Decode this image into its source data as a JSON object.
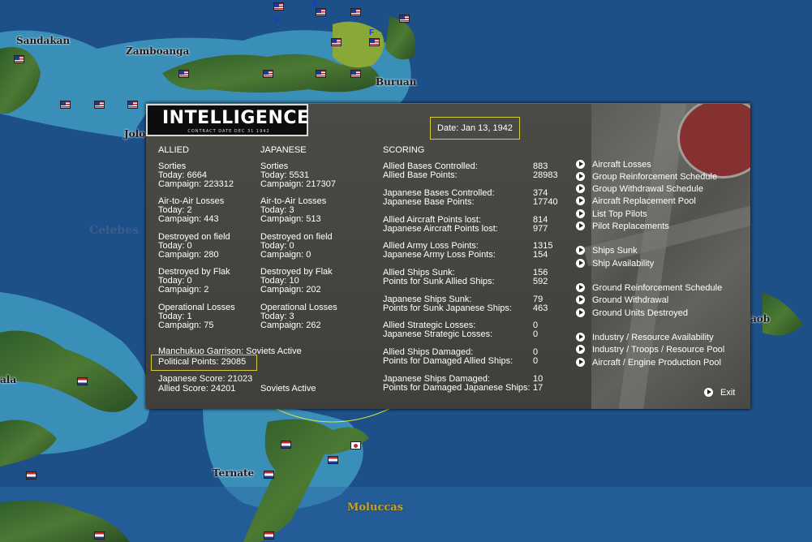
{
  "map": {
    "places": [
      "Sandakan",
      "Zamboanga",
      "Buruan",
      "Jolo",
      "Celebes",
      "Ternate",
      "Moluccas",
      "ala",
      "aob"
    ]
  },
  "intel": {
    "title": "INTELLIGENCE",
    "subtitle": "CONTRACT DATE DEC 31 1942",
    "date": "Date: Jan 13, 1942",
    "allied_header": "ALLIED",
    "japanese_header": "JAPANESE",
    "scoring_header": "SCORING",
    "allied": {
      "sorties": "Sorties",
      "sorties_today": "Today:     6664",
      "sorties_campaign": "Campaign: 223312",
      "a2a": "Air-to-Air Losses",
      "a2a_today": "Today:     2",
      "a2a_campaign": "Campaign: 443",
      "field": "Destroyed on field",
      "field_today": "Today:     0",
      "field_campaign": "Campaign: 280",
      "flak": "Destroyed by Flak",
      "flak_today": "Today:     0",
      "flak_campaign": "Campaign: 2",
      "ops": "Operational Losses",
      "ops_today": "Today:     1",
      "ops_campaign": "Campaign: 75"
    },
    "japanese": {
      "sorties": "Sorties",
      "sorties_today": "Today:     5531",
      "sorties_campaign": "Campaign: 217307",
      "a2a": "Air-to-Air Losses",
      "a2a_today": "Today:     3",
      "a2a_campaign": "Campaign: 513",
      "field": "Destroyed on field",
      "field_today": "Today:     0",
      "field_campaign": "Campaign: 0",
      "flak": "Destroyed by Flak",
      "flak_today": "Today:     10",
      "flak_campaign": "Campaign: 202",
      "ops": "Operational Losses",
      "ops_today": "Today:     3",
      "ops_campaign": "Campaign: 262"
    },
    "garrison": "Manchukuo Garrison: Soviets Active",
    "political_points": "Political Points: 29085",
    "japanese_score": "Japanese Score: 21023",
    "allied_score": "Allied Score: 24201",
    "soviets": "Soviets Active",
    "scoring": [
      {
        "labels": [
          "Allied Bases Controlled:",
          "Allied Base Points:"
        ],
        "values": [
          "883",
          "28983"
        ]
      },
      {
        "labels": [
          "Japanese Bases Controlled:",
          "Japanese Base Points:"
        ],
        "values": [
          "374",
          "17740"
        ]
      },
      {
        "labels": [
          "Allied Aircraft Points lost:",
          "Japanese Aircraft Points lost:"
        ],
        "values": [
          "814",
          "977"
        ]
      },
      {
        "labels": [
          "Allied Army Loss Points:",
          "Japanese Army Loss Points:"
        ],
        "values": [
          "1315",
          "154"
        ]
      },
      {
        "labels": [
          "Allied Ships Sunk:",
          "Points for Sunk Allied Ships:"
        ],
        "values": [
          "156",
          "592"
        ]
      },
      {
        "labels": [
          "Japanese Ships Sunk:",
          "Points for Sunk Japanese Ships:"
        ],
        "values": [
          "79",
          "463"
        ]
      },
      {
        "labels": [
          "Allied Strategic Losses:",
          "Japanese Strategic Losses:"
        ],
        "values": [
          "0",
          "0"
        ]
      },
      {
        "labels": [
          "Allied Ships Damaged:",
          "Points for Damaged Allied Ships:"
        ],
        "values": [
          "0",
          "0"
        ]
      },
      {
        "labels": [
          "Japanese Ships Damaged:",
          "Points for Damaged Japanese Ships:"
        ],
        "values": [
          "10",
          "17"
        ]
      }
    ],
    "links": [
      "Aircraft Losses",
      "Group Reinforcement Schedule",
      "Group Withdrawal Schedule",
      "Aircraft Replacement Pool",
      "List Top Pilots",
      "Pilot Replacements",
      "Ships Sunk",
      "Ship Availability",
      "Ground Reinforcement Schedule",
      "Ground Withdrawal",
      "Ground Units Destroyed",
      "Industry / Resource Availability",
      "Industry / Troops / Resource Pool",
      "Aircraft / Engine Production Pool"
    ],
    "exit": "Exit"
  }
}
